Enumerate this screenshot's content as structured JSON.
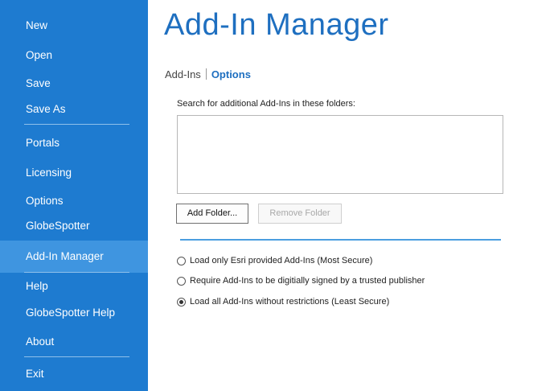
{
  "sidebar": {
    "items": [
      {
        "label": "New"
      },
      {
        "label": "Open"
      },
      {
        "label": "Save"
      },
      {
        "label": "Save As"
      },
      {
        "label": "Portals"
      },
      {
        "label": "Licensing"
      },
      {
        "label": "Options"
      },
      {
        "label": "GlobeSpotter"
      },
      {
        "label": "Add-In Manager",
        "active": true
      },
      {
        "label": "Help"
      },
      {
        "label": "GlobeSpotter Help"
      },
      {
        "label": "About"
      },
      {
        "label": "Exit"
      }
    ],
    "background": "#1e7bd0",
    "active_background": "#3f95e0"
  },
  "main": {
    "title": "Add-In Manager",
    "tabs": [
      {
        "label": "Add-Ins",
        "active": false
      },
      {
        "label": "Options",
        "active": true
      }
    ],
    "search_label": "Search for additional Add-Ins in these folders:",
    "folders": [],
    "buttons": {
      "add_folder": "Add Folder...",
      "remove_folder": "Remove Folder"
    },
    "security_options": [
      {
        "label": "Load only Esri provided Add-Ins (Most Secure)",
        "checked": false
      },
      {
        "label": "Require Add-Ins to be digitially signed by a trusted publisher",
        "checked": false
      },
      {
        "label": "Load all Add-Ins without restrictions (Least Secure)",
        "checked": true
      }
    ],
    "accent": "#1e6fc0"
  }
}
